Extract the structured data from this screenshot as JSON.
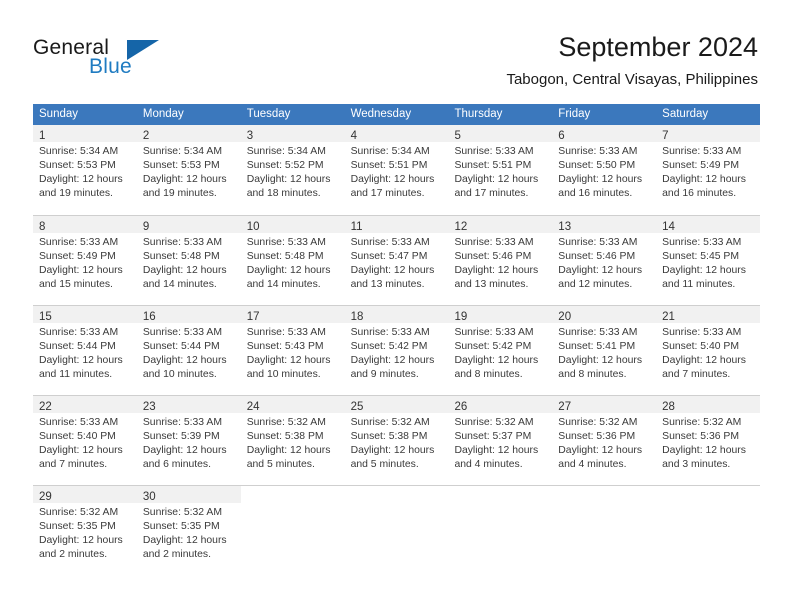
{
  "logo": {
    "primary_text": "General",
    "secondary_text": "Blue",
    "accent_color": "#1565a8",
    "blue_text_color": "#1f7bc1"
  },
  "header": {
    "title": "September 2024",
    "location": "Tabogon, Central Visayas, Philippines",
    "header_bg_color": "#3b78bd",
    "daynum_band_color": "#f1f1f1"
  },
  "weekdays": [
    "Sunday",
    "Monday",
    "Tuesday",
    "Wednesday",
    "Thursday",
    "Friday",
    "Saturday"
  ],
  "weeks": [
    [
      {
        "day": "1",
        "sunrise": "Sunrise: 5:34 AM",
        "sunset": "Sunset: 5:53 PM",
        "daylight_line1": "Daylight: 12 hours",
        "daylight_line2": "and 19 minutes."
      },
      {
        "day": "2",
        "sunrise": "Sunrise: 5:34 AM",
        "sunset": "Sunset: 5:53 PM",
        "daylight_line1": "Daylight: 12 hours",
        "daylight_line2": "and 19 minutes."
      },
      {
        "day": "3",
        "sunrise": "Sunrise: 5:34 AM",
        "sunset": "Sunset: 5:52 PM",
        "daylight_line1": "Daylight: 12 hours",
        "daylight_line2": "and 18 minutes."
      },
      {
        "day": "4",
        "sunrise": "Sunrise: 5:34 AM",
        "sunset": "Sunset: 5:51 PM",
        "daylight_line1": "Daylight: 12 hours",
        "daylight_line2": "and 17 minutes."
      },
      {
        "day": "5",
        "sunrise": "Sunrise: 5:33 AM",
        "sunset": "Sunset: 5:51 PM",
        "daylight_line1": "Daylight: 12 hours",
        "daylight_line2": "and 17 minutes."
      },
      {
        "day": "6",
        "sunrise": "Sunrise: 5:33 AM",
        "sunset": "Sunset: 5:50 PM",
        "daylight_line1": "Daylight: 12 hours",
        "daylight_line2": "and 16 minutes."
      },
      {
        "day": "7",
        "sunrise": "Sunrise: 5:33 AM",
        "sunset": "Sunset: 5:49 PM",
        "daylight_line1": "Daylight: 12 hours",
        "daylight_line2": "and 16 minutes."
      }
    ],
    [
      {
        "day": "8",
        "sunrise": "Sunrise: 5:33 AM",
        "sunset": "Sunset: 5:49 PM",
        "daylight_line1": "Daylight: 12 hours",
        "daylight_line2": "and 15 minutes."
      },
      {
        "day": "9",
        "sunrise": "Sunrise: 5:33 AM",
        "sunset": "Sunset: 5:48 PM",
        "daylight_line1": "Daylight: 12 hours",
        "daylight_line2": "and 14 minutes."
      },
      {
        "day": "10",
        "sunrise": "Sunrise: 5:33 AM",
        "sunset": "Sunset: 5:48 PM",
        "daylight_line1": "Daylight: 12 hours",
        "daylight_line2": "and 14 minutes."
      },
      {
        "day": "11",
        "sunrise": "Sunrise: 5:33 AM",
        "sunset": "Sunset: 5:47 PM",
        "daylight_line1": "Daylight: 12 hours",
        "daylight_line2": "and 13 minutes."
      },
      {
        "day": "12",
        "sunrise": "Sunrise: 5:33 AM",
        "sunset": "Sunset: 5:46 PM",
        "daylight_line1": "Daylight: 12 hours",
        "daylight_line2": "and 13 minutes."
      },
      {
        "day": "13",
        "sunrise": "Sunrise: 5:33 AM",
        "sunset": "Sunset: 5:46 PM",
        "daylight_line1": "Daylight: 12 hours",
        "daylight_line2": "and 12 minutes."
      },
      {
        "day": "14",
        "sunrise": "Sunrise: 5:33 AM",
        "sunset": "Sunset: 5:45 PM",
        "daylight_line1": "Daylight: 12 hours",
        "daylight_line2": "and 11 minutes."
      }
    ],
    [
      {
        "day": "15",
        "sunrise": "Sunrise: 5:33 AM",
        "sunset": "Sunset: 5:44 PM",
        "daylight_line1": "Daylight: 12 hours",
        "daylight_line2": "and 11 minutes."
      },
      {
        "day": "16",
        "sunrise": "Sunrise: 5:33 AM",
        "sunset": "Sunset: 5:44 PM",
        "daylight_line1": "Daylight: 12 hours",
        "daylight_line2": "and 10 minutes."
      },
      {
        "day": "17",
        "sunrise": "Sunrise: 5:33 AM",
        "sunset": "Sunset: 5:43 PM",
        "daylight_line1": "Daylight: 12 hours",
        "daylight_line2": "and 10 minutes."
      },
      {
        "day": "18",
        "sunrise": "Sunrise: 5:33 AM",
        "sunset": "Sunset: 5:42 PM",
        "daylight_line1": "Daylight: 12 hours",
        "daylight_line2": "and 9 minutes."
      },
      {
        "day": "19",
        "sunrise": "Sunrise: 5:33 AM",
        "sunset": "Sunset: 5:42 PM",
        "daylight_line1": "Daylight: 12 hours",
        "daylight_line2": "and 8 minutes."
      },
      {
        "day": "20",
        "sunrise": "Sunrise: 5:33 AM",
        "sunset": "Sunset: 5:41 PM",
        "daylight_line1": "Daylight: 12 hours",
        "daylight_line2": "and 8 minutes."
      },
      {
        "day": "21",
        "sunrise": "Sunrise: 5:33 AM",
        "sunset": "Sunset: 5:40 PM",
        "daylight_line1": "Daylight: 12 hours",
        "daylight_line2": "and 7 minutes."
      }
    ],
    [
      {
        "day": "22",
        "sunrise": "Sunrise: 5:33 AM",
        "sunset": "Sunset: 5:40 PM",
        "daylight_line1": "Daylight: 12 hours",
        "daylight_line2": "and 7 minutes."
      },
      {
        "day": "23",
        "sunrise": "Sunrise: 5:33 AM",
        "sunset": "Sunset: 5:39 PM",
        "daylight_line1": "Daylight: 12 hours",
        "daylight_line2": "and 6 minutes."
      },
      {
        "day": "24",
        "sunrise": "Sunrise: 5:32 AM",
        "sunset": "Sunset: 5:38 PM",
        "daylight_line1": "Daylight: 12 hours",
        "daylight_line2": "and 5 minutes."
      },
      {
        "day": "25",
        "sunrise": "Sunrise: 5:32 AM",
        "sunset": "Sunset: 5:38 PM",
        "daylight_line1": "Daylight: 12 hours",
        "daylight_line2": "and 5 minutes."
      },
      {
        "day": "26",
        "sunrise": "Sunrise: 5:32 AM",
        "sunset": "Sunset: 5:37 PM",
        "daylight_line1": "Daylight: 12 hours",
        "daylight_line2": "and 4 minutes."
      },
      {
        "day": "27",
        "sunrise": "Sunrise: 5:32 AM",
        "sunset": "Sunset: 5:36 PM",
        "daylight_line1": "Daylight: 12 hours",
        "daylight_line2": "and 4 minutes."
      },
      {
        "day": "28",
        "sunrise": "Sunrise: 5:32 AM",
        "sunset": "Sunset: 5:36 PM",
        "daylight_line1": "Daylight: 12 hours",
        "daylight_line2": "and 3 minutes."
      }
    ],
    [
      {
        "day": "29",
        "sunrise": "Sunrise: 5:32 AM",
        "sunset": "Sunset: 5:35 PM",
        "daylight_line1": "Daylight: 12 hours",
        "daylight_line2": "and 2 minutes."
      },
      {
        "day": "30",
        "sunrise": "Sunrise: 5:32 AM",
        "sunset": "Sunset: 5:35 PM",
        "daylight_line1": "Daylight: 12 hours",
        "daylight_line2": "and 2 minutes."
      },
      {
        "day": "",
        "sunrise": "",
        "sunset": "",
        "daylight_line1": "",
        "daylight_line2": ""
      },
      {
        "day": "",
        "sunrise": "",
        "sunset": "",
        "daylight_line1": "",
        "daylight_line2": ""
      },
      {
        "day": "",
        "sunrise": "",
        "sunset": "",
        "daylight_line1": "",
        "daylight_line2": ""
      },
      {
        "day": "",
        "sunrise": "",
        "sunset": "",
        "daylight_line1": "",
        "daylight_line2": ""
      },
      {
        "day": "",
        "sunrise": "",
        "sunset": "",
        "daylight_line1": "",
        "daylight_line2": ""
      }
    ]
  ]
}
